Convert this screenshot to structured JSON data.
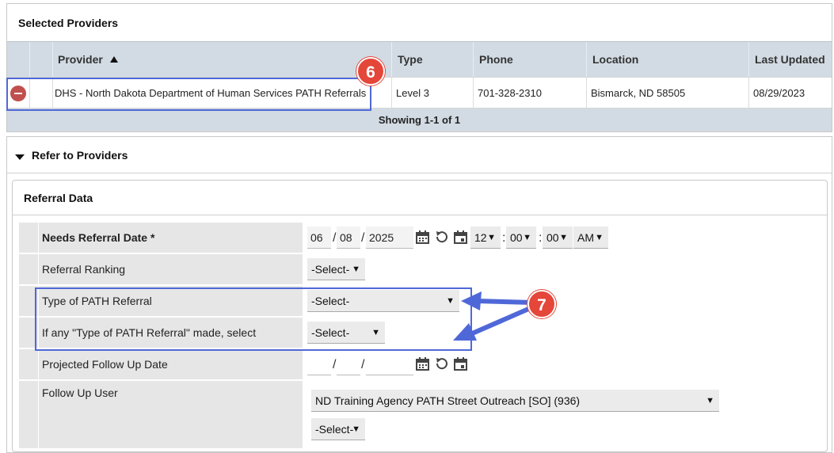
{
  "selected_providers": {
    "title": "Selected Providers",
    "columns": {
      "provider": "Provider",
      "type": "Type",
      "phone": "Phone",
      "location": "Location",
      "last_updated": "Last Updated"
    },
    "sort_indicator": "sort-ascending-icon",
    "rows": [
      {
        "provider": "DHS - North Dakota Department of Human Services PATH Referrals",
        "type": "Level 3",
        "phone": "701-328-2310",
        "location": "Bismarck, ND 58505",
        "last_updated": "08/29/2023"
      }
    ],
    "footer": "Showing 1-1 of 1"
  },
  "refer": {
    "title": "Refer to Providers",
    "referral_data": {
      "title": "Referral Data",
      "needs_referral_date": {
        "label": "Needs Referral Date *",
        "month": "06",
        "day": "08",
        "year": "2025",
        "hour": "12",
        "minute": "00",
        "second": "00",
        "ampm": "AM"
      },
      "referral_ranking": {
        "label": "Referral Ranking",
        "value": "-Select-"
      },
      "type_of_path_referral": {
        "label": "Type of PATH Referral",
        "value": "-Select-"
      },
      "outcome": {
        "label": "If any \"Type of PATH Referral\" made, select Outcome",
        "value": "-Select-"
      },
      "projected_follow_up": {
        "label": "Projected Follow Up Date",
        "month": "",
        "day": "",
        "year": ""
      },
      "follow_up_user": {
        "label": "Follow Up User",
        "value": "ND Training Agency PATH Street Outreach [SO] (936)",
        "second_value": "-Select-"
      }
    }
  },
  "annotations": {
    "six": "6",
    "seven": "7"
  },
  "colors": {
    "highlight": "#4f68d8",
    "badge": "#e4463a",
    "header_bg": "#d2dbe3",
    "link": "#2a6f8f",
    "remove": "#c0504d"
  }
}
